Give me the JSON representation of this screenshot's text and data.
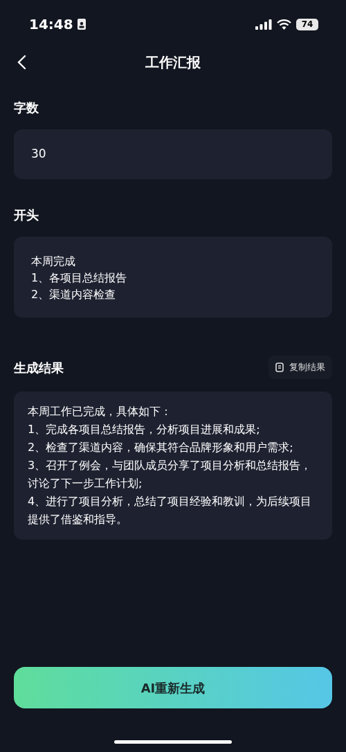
{
  "status_bar": {
    "time": "14:48",
    "battery": "74"
  },
  "nav": {
    "title": "工作汇报"
  },
  "word_count": {
    "label": "字数",
    "value": "30"
  },
  "opening": {
    "label": "开头",
    "lines": [
      "本周完成",
      "1、各项目总结报告",
      "2、渠道内容检查"
    ]
  },
  "result": {
    "label": "生成结果",
    "copy_button": "复制结果",
    "paragraphs": [
      "本周工作已完成，具体如下：",
      "1、完成各项目总结报告，分析项目进展和成果;",
      "2、检查了渠道内容，确保其符合品牌形象和用户需求;",
      "3、召开了例会，与团队成员分享了项目分析和总结报告，讨论了下一步工作计划;",
      "4、进行了项目分析，总结了项目经验和教训，为后续项目提供了借鉴和指导。"
    ]
  },
  "regenerate_button": "AI重新生成"
}
